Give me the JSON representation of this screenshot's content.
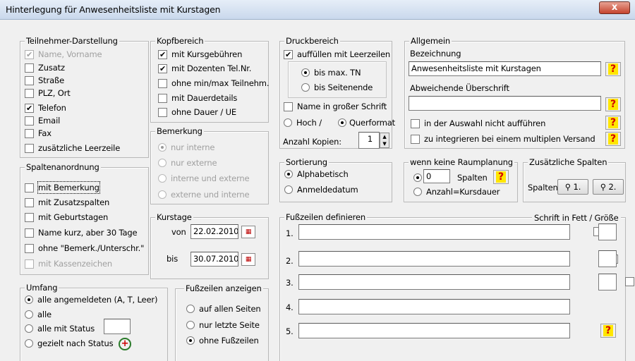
{
  "window": {
    "title": "Hinterlegung für Anwesenheitsliste mit Kurstagen",
    "close": "x"
  },
  "teilnehmer": {
    "title": "Teilnehmer-Darstellung",
    "items": [
      {
        "label": "Name, Vorname",
        "checked": true,
        "disabled": true
      },
      {
        "label": "Zusatz",
        "checked": false
      },
      {
        "label": "Straße",
        "checked": false
      },
      {
        "label": "PLZ, Ort",
        "checked": false
      },
      {
        "label": "Telefon",
        "checked": true
      },
      {
        "label": "Email",
        "checked": false
      },
      {
        "label": "Fax",
        "checked": false
      },
      {
        "label": "zusätzliche Leerzeile",
        "checked": false
      }
    ]
  },
  "kopf": {
    "title": "Kopfbereich",
    "items": [
      {
        "label": "mit Kursgebühren",
        "checked": true
      },
      {
        "label": "mit Dozenten Tel.Nr.",
        "checked": true
      },
      {
        "label": "ohne min/max Teilnehm.",
        "checked": false
      },
      {
        "label": "mit Dauerdetails",
        "checked": false
      },
      {
        "label": "ohne Dauer / UE",
        "checked": false
      }
    ]
  },
  "druck": {
    "title": "Druckbereich",
    "fill_label": "auffüllen mit Leerzeilen",
    "opt1": "bis max. TN",
    "opt2": "bis Seitenende",
    "big_name": "Name in großer Schrift",
    "hoch": "Hoch /",
    "quer": "Querformat",
    "kopien_label": "Anzahl Kopien:",
    "kopien_value": "1"
  },
  "allgemein": {
    "title": "Allgemein",
    "bez_label": "Bezeichnung",
    "bez_value": "Anwesenheitsliste mit Kurstagen",
    "ueber_label": "Abweichende Überschrift",
    "ueber_value": "",
    "cb1": "in der Auswahl nicht aufführen",
    "cb2": "zu integrieren bei einem multiplen Versand",
    "help": "?"
  },
  "spalten": {
    "title": "Spaltenanordnung",
    "items": [
      {
        "label": "mit Bemerkung",
        "checked": false
      },
      {
        "label": "mit Zusatzspalten",
        "checked": false
      },
      {
        "label": "mit Geburtstagen",
        "checked": false
      },
      {
        "label": "Name kurz, aber 30 Tage",
        "checked": false
      },
      {
        "label": "ohne \"Bemerk./Unterschr.\"",
        "checked": false
      },
      {
        "label": "mit Kassenzeichen",
        "checked": false,
        "disabled": true
      }
    ]
  },
  "bemerkung": {
    "title": "Bemerkung",
    "items": [
      "nur interne",
      "nur externe",
      "interne und externe",
      "externe und interne"
    ]
  },
  "sortierung": {
    "title": "Sortierung",
    "opt1": "Alphabetisch",
    "opt2": "Anmeldedatum"
  },
  "raum": {
    "title": "wenn keine Raumplanung",
    "value": "0",
    "spalten": "Spalten",
    "anzahl": "Anzahl=Kursdauer"
  },
  "zusatz": {
    "title": "Zusätzliche Spalten",
    "label": "Spalten",
    "btn1": "1.",
    "btn2": "2."
  },
  "kurstage": {
    "title": "Kurstage",
    "von_label": "von",
    "von": "22.02.2010",
    "bis_label": "bis",
    "bis": "30.07.2010"
  },
  "fuss": {
    "title": "Fußzeilen definieren",
    "right_title": "Schrift in Fett / Größe",
    "rows": [
      "1.",
      "2.",
      "3.",
      "4.",
      "5."
    ]
  },
  "umfang": {
    "title": "Umfang",
    "items": [
      "alle angemeldeten (A, T, Leer)",
      "alle",
      "alle mit Status",
      "gezielt nach Status"
    ]
  },
  "fussanz": {
    "title": "Fußzeilen anzeigen",
    "items": [
      "auf allen Seiten",
      "nur letzte Seite",
      "ohne Fußzeilen"
    ]
  }
}
